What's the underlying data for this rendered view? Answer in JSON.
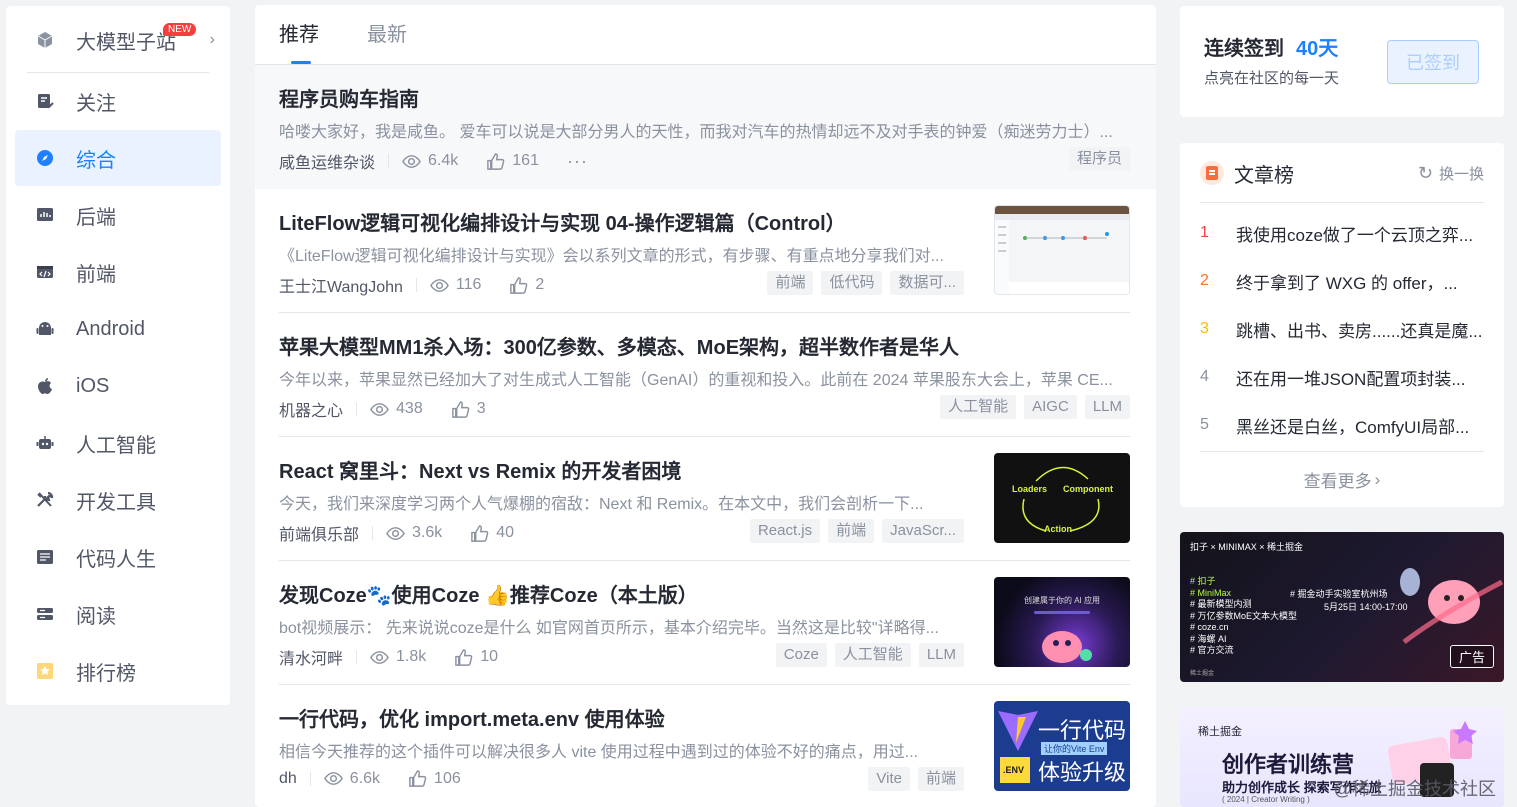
{
  "sidebar": {
    "items": [
      {
        "label": "大模型子站",
        "badge": "NEW",
        "icon": "cube-icon"
      },
      {
        "label": "关注",
        "icon": "follow-icon"
      },
      {
        "label": "综合",
        "icon": "compass-icon"
      },
      {
        "label": "后端",
        "icon": "backend-icon"
      },
      {
        "label": "前端",
        "icon": "frontend-icon"
      },
      {
        "label": "Android",
        "icon": "android-icon"
      },
      {
        "label": "iOS",
        "icon": "apple-icon"
      },
      {
        "label": "人工智能",
        "icon": "robot-icon"
      },
      {
        "label": "开发工具",
        "icon": "tools-icon"
      },
      {
        "label": "代码人生",
        "icon": "code-life-icon"
      },
      {
        "label": "阅读",
        "icon": "reading-icon"
      },
      {
        "label": "排行榜",
        "icon": "ranking-icon"
      }
    ],
    "active_index": 2
  },
  "feed": {
    "tabs": [
      "推荐",
      "最新"
    ],
    "active_tab": 0,
    "articles": [
      {
        "title": "程序员购车指南",
        "abstract": "哈喽大家好，我是咸鱼。 爱车可以说是大部分男人的天性，而我对汽车的热情却远不及对手表的钟爱（痴迷劳力士）...",
        "author": "咸鱼运维杂谈",
        "views": "6.4k",
        "likes": "161",
        "more": "···",
        "tags": [
          "程序员"
        ]
      },
      {
        "title": "LiteFlow逻辑可视化编排设计与实现 04-操作逻辑篇（Control）",
        "abstract": "《LiteFlow逻辑可视化编排设计与实现》会以系列文章的形式，有步骤、有重点地分享我们对...",
        "author": "王士江WangJohn",
        "views": "116",
        "likes": "2",
        "tags": [
          "前端",
          "低代码",
          "数据可..."
        ]
      },
      {
        "title": "苹果大模型MM1杀入场：300亿参数、多模态、MoE架构，超半数作者是华人",
        "abstract": "今年以来，苹果显然已经加大了对生成式人工智能（GenAI）的重视和投入。此前在 2024 苹果股东大会上，苹果 CE...",
        "author": "机器之心",
        "views": "438",
        "likes": "3",
        "tags": [
          "人工智能",
          "AIGC",
          "LLM"
        ]
      },
      {
        "title": "React 窝里斗：Next vs Remix 的开发者困境",
        "abstract": "今天，我们来深度学习两个人气爆棚的宿敌：Next 和 Remix。在本文中，我们会剖析一下...",
        "author": "前端俱乐部",
        "views": "3.6k",
        "likes": "40",
        "tags": [
          "React.js",
          "前端",
          "JavaScr..."
        ],
        "thumb": {
          "l1": "Loaders",
          "l2": "Component",
          "l3": "Action"
        }
      },
      {
        "title": "发现Coze🐾使用Coze 👍推荐Coze（本土版）",
        "abstract": "bot视频展示： 先来说说coze是什么 如官网首页所示，基本介绍完毕。当然这是比较\"详略得...",
        "author": "清水河畔",
        "views": "1.8k",
        "likes": "10",
        "tags": [
          "Coze",
          "人工智能",
          "LLM"
        ],
        "thumb": {
          "l1": "创建属于你的 AI 应用"
        }
      },
      {
        "title": "一行代码，优化 import.meta.env 使用体验",
        "abstract": "相信今天推荐的这个插件可以解决很多人 vite 使用过程中遇到过的体验不好的痛点，用过...",
        "author": "dh",
        "views": "6.6k",
        "likes": "106",
        "tags": [
          "Vite",
          "前端"
        ],
        "thumb": {
          "l1": "一行代码",
          "l2": "让你的Vite Env",
          "l3": "体验升级",
          "l4": ".ENV"
        }
      }
    ]
  },
  "signin": {
    "title": "连续签到",
    "days": "40天",
    "subtitle": "点亮在社区的每一天",
    "button": "已签到"
  },
  "rank": {
    "title": "文章榜",
    "refresh": "换一换",
    "items": [
      {
        "num": "1",
        "text": "我使用coze做了一个云顶之弈..."
      },
      {
        "num": "2",
        "text": "终于拿到了 WXG 的 offer，..."
      },
      {
        "num": "3",
        "text": "跳槽、出书、卖房......还真是魔..."
      },
      {
        "num": "4",
        "text": "还在用一堆JSON配置项封装..."
      },
      {
        "num": "5",
        "text": "黑丝还是白丝，ComfyUI局部..."
      }
    ],
    "more": "查看更多",
    "num_colors": [
      "#f04142",
      "#ff7426",
      "#ffb800",
      "#8a919f",
      "#8a919f"
    ]
  },
  "ads": {
    "ad1": {
      "logos": "扣子 × MINIMAX × 稀土掘金",
      "lines": [
        "# 扣子",
        "# MiniMax",
        "# 最新模型内测",
        "# 万亿参数MoE文本大模型",
        "# coze.cn",
        "# 海螺 AI",
        "# 官方交流"
      ],
      "event": "# 掘金动手实验室杭州场",
      "date": "5月25日 14:00-17:00",
      "label": "广告",
      "footer": "稀土掘金"
    },
    "ad2": {
      "brand": "稀土掘金",
      "title": "创作者训练营",
      "subtitle": "助力创作成长 探索写作之旅",
      "tiny": "( 2024 | Creator Writing )",
      "watermark": "@稀土掘金技术社区"
    }
  },
  "colors": {
    "accent": "#1e80ff",
    "text": "#252933",
    "muted": "#8a919f",
    "bg": "#f2f3f5"
  }
}
